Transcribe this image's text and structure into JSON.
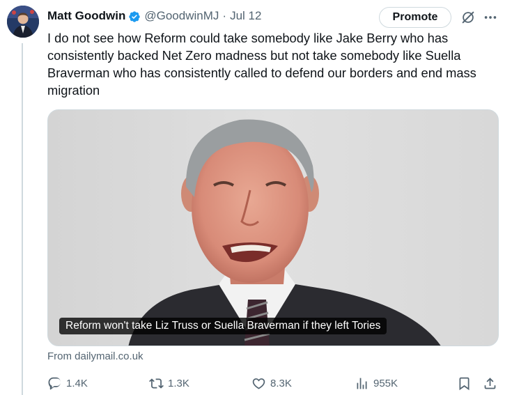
{
  "tweet": {
    "author_name": "Matt Goodwin",
    "handle": "@GoodwinMJ",
    "separator": "·",
    "date": "Jul 12",
    "promote_label": "Promote",
    "text": "I do not see how Reform could take somebody like Jake Berry who has consistently backed Net Zero madness but not take somebody like Suella Braverman who has consistently called to defend our borders and end mass migration",
    "media_caption": "Reform won't take Liz Truss or Suella Braverman if they left Tories",
    "source": "From dailymail.co.uk"
  },
  "actions": {
    "replies": "1.4K",
    "reposts": "1.3K",
    "likes": "8.3K",
    "views": "955K"
  },
  "colors": {
    "text_primary": "#0f1419",
    "text_secondary": "#536471",
    "verified_blue": "#1d9bf0",
    "border": "#cfd9de"
  },
  "icons": [
    "verified-badge-icon",
    "grok-icon",
    "more-icon",
    "reply-icon",
    "repost-icon",
    "like-icon",
    "views-icon",
    "bookmark-icon",
    "share-icon"
  ]
}
